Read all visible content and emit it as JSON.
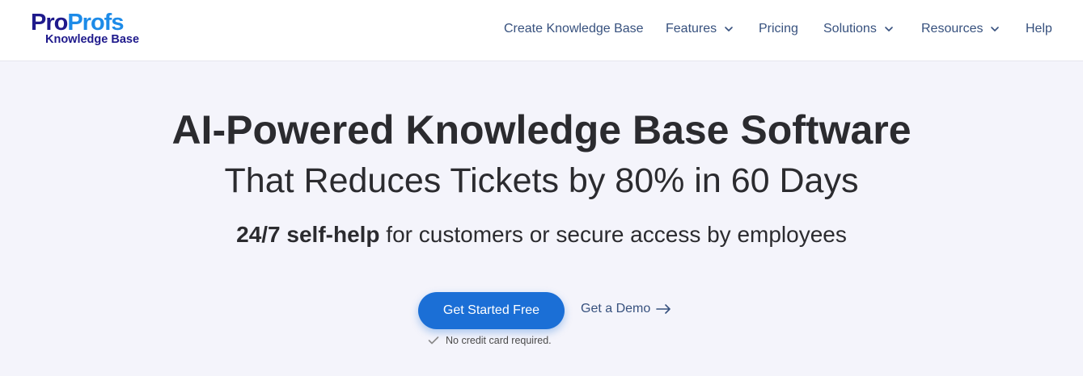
{
  "logo": {
    "pro": "Pro",
    "profs": "Profs",
    "subtitle": "Knowledge Base"
  },
  "nav": {
    "create_kb": "Create Knowledge Base",
    "features": "Features",
    "pricing": "Pricing",
    "solutions": "Solutions",
    "resources": "Resources",
    "help": "Help"
  },
  "hero": {
    "headline": "AI-Powered Knowledge Base Software",
    "subheadline": "That Reduces Tickets by 80% in 60 Days",
    "tagline_bold": "24/7 self-help",
    "tagline_rest": " for customers or secure access by employees",
    "cta_label": "Get Started Free",
    "demo_label": "Get a Demo",
    "note": "No credit card required."
  },
  "colors": {
    "brand_dark": "#1f1a8c",
    "brand_light": "#1d8be8",
    "cta": "#1b6fd6",
    "nav_text": "#37517e",
    "heading_text": "#2b2b2f",
    "hero_bg": "#f4f4fb"
  },
  "icons": {
    "dropdown": "chevron-down-icon",
    "demo_arrow": "arrow-right-icon",
    "note_check": "check-icon"
  }
}
